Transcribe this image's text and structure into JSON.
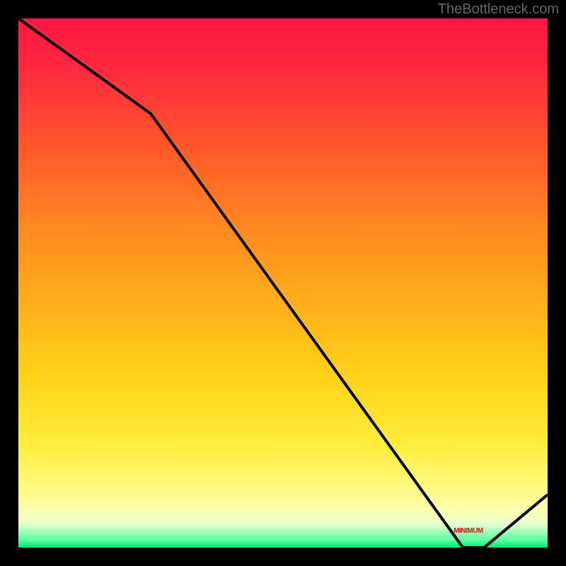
{
  "watermark": "TheBottleneck.com",
  "minimum_label": "MINIMUM",
  "chart_data": {
    "type": "line",
    "title": "",
    "xlabel": "",
    "ylabel": "",
    "xlim": [
      0,
      100
    ],
    "ylim": [
      0,
      100
    ],
    "x": [
      0,
      25,
      84,
      88,
      100
    ],
    "values": [
      100,
      82,
      0,
      0,
      10
    ],
    "minimum_region": {
      "x_start": 82,
      "x_end": 90
    },
    "gradient_stops": [
      {
        "offset": 0,
        "color": "#ff1744"
      },
      {
        "offset": 0.1,
        "color": "#ff2a3f"
      },
      {
        "offset": 0.25,
        "color": "#ff5a2a"
      },
      {
        "offset": 0.4,
        "color": "#ff8a1f"
      },
      {
        "offset": 0.55,
        "color": "#ffb21a"
      },
      {
        "offset": 0.68,
        "color": "#ffd31a"
      },
      {
        "offset": 0.8,
        "color": "#ffec3a"
      },
      {
        "offset": 0.88,
        "color": "#fff97a"
      },
      {
        "offset": 0.93,
        "color": "#fdffb0"
      },
      {
        "offset": 0.955,
        "color": "#e8ffd0"
      },
      {
        "offset": 0.97,
        "color": "#9fffb8"
      },
      {
        "offset": 0.985,
        "color": "#5dffa0"
      },
      {
        "offset": 1.0,
        "color": "#00e676"
      }
    ]
  },
  "colors": {
    "background": "#000000",
    "line": "#000000",
    "minimum_label": "#e02020",
    "watermark": "#666666"
  }
}
